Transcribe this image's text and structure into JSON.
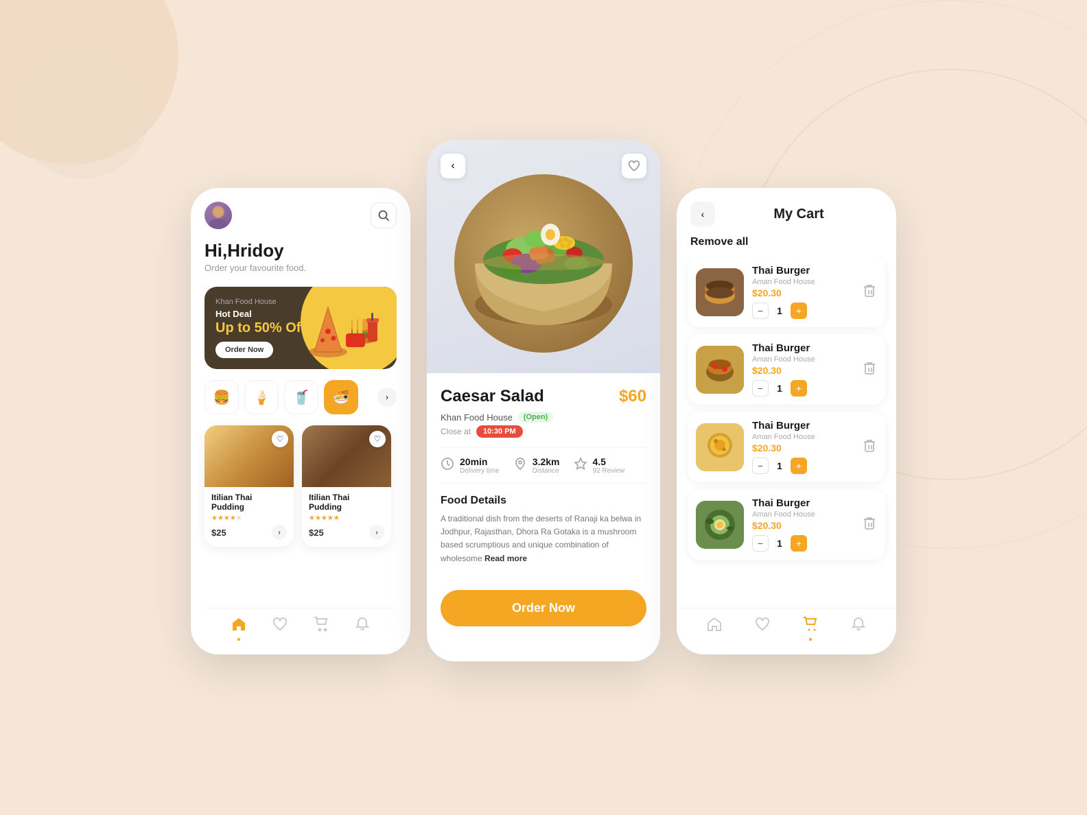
{
  "background": {
    "color": "#f5e6d8"
  },
  "phone1": {
    "header": {
      "greeting": "Hi,Hridoy",
      "subtitle": "Order your favourite food."
    },
    "promo": {
      "store": "Khan Food House",
      "hot_deal": "Hot Deal",
      "discount": "Up to 50% Off",
      "cta": "Order Now"
    },
    "categories": [
      {
        "icon": "🍔",
        "label": "burger",
        "active": false
      },
      {
        "icon": "🍦",
        "label": "dessert",
        "active": false
      },
      {
        "icon": "🥤",
        "label": "drinks",
        "active": false
      },
      {
        "icon": "🍜",
        "label": "noodles",
        "active": true
      }
    ],
    "food_cards": [
      {
        "name": "Itilian Thai Pudding",
        "stars": 4,
        "price": "$25"
      },
      {
        "name": "Itilian Thai Pudding",
        "stars": 5,
        "price": "$25"
      }
    ],
    "nav": [
      "home",
      "heart",
      "cart",
      "bell"
    ]
  },
  "phone2": {
    "food_name": "Caesar Salad",
    "price": "$60",
    "store": "Khan Food House",
    "status": "Open",
    "close_label": "Close at",
    "close_time": "10:30 PM",
    "stats": {
      "delivery_time": "20min",
      "delivery_label": "Delivery time",
      "distance": "3.2km",
      "distance_label": "Distance",
      "rating": "4.5",
      "rating_label": "92 Review"
    },
    "details_title": "Food Details",
    "details_text": "A traditional dish from the deserts of Ranaji ka belwa in Jodhpur, Rajasthan, Dhora Ra Gotaka is a mushroom based scrumptious and unique combination of wholesome",
    "read_more": "Read more",
    "cta": "Order Now"
  },
  "phone3": {
    "title": "My Cart",
    "remove_all": "Remove all",
    "items": [
      {
        "name": "Thai Burger",
        "store": "Aman Food House",
        "price": "$20.30",
        "qty": 1,
        "img_class": "cart-item-img-1"
      },
      {
        "name": "Thai Burger",
        "store": "Aman Food House",
        "price": "$20.30",
        "qty": 1,
        "img_class": "cart-item-img-2"
      },
      {
        "name": "Thai Burger",
        "store": "Aman Food House",
        "price": "$20.30",
        "qty": 1,
        "img_class": "cart-item-img-3"
      },
      {
        "name": "Thai Burger",
        "store": "Aman Food House",
        "price": "$20.30",
        "qty": 1,
        "img_class": "cart-item-img-4"
      }
    ],
    "nav": [
      "home",
      "heart",
      "cart-active",
      "bell"
    ]
  }
}
